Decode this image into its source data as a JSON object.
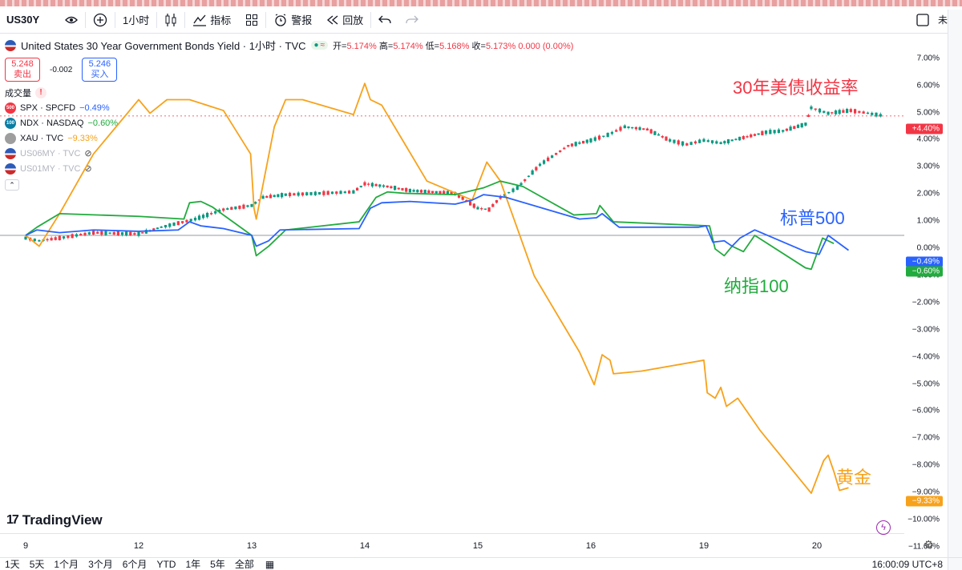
{
  "toolbar": {
    "symbol": "US30Y",
    "interval": "1小时",
    "indicators_label": "指标",
    "alert_label": "警报",
    "replay_label": "回放",
    "right_label": "未命"
  },
  "legend": {
    "main_title": "United States 30 Year Government Bonds Yield · 1小时 · TVC",
    "ohlc": {
      "open_label": "开=",
      "open": "5.174%",
      "high_label": "高=",
      "high": "5.174%",
      "low_label": "低=",
      "low": "5.168%",
      "close_label": "收=",
      "close": "5.173%",
      "change": "0.000 (0.00%)"
    },
    "sell_price": "5.248",
    "sell_label": "卖出",
    "spread": "-0.002",
    "buy_price": "5.246",
    "buy_label": "买入",
    "volume_label": "成交量",
    "rows": [
      {
        "icon": "500",
        "symbol": "SPX · SPCFD",
        "value": "−0.49%",
        "color": "#2962ff"
      },
      {
        "icon": "100",
        "symbol": "NDX · NASDAQ",
        "value": "−0.60%",
        "color": "#22ab3e"
      },
      {
        "icon": "",
        "symbol": "XAU · TVC",
        "value": "−9.33%",
        "color": "#f7a21b"
      },
      {
        "icon": "",
        "symbol": "US06MY · TVC",
        "value": "",
        "color": "#b2b5be"
      },
      {
        "icon": "",
        "symbol": "US01MY · TVC",
        "value": "",
        "color": "#b2b5be"
      }
    ]
  },
  "annotations": {
    "bond": "30年美债收益率",
    "spx": "标普500",
    "ndx": "纳指100",
    "gold": "黄金"
  },
  "ranges": [
    "1天",
    "5天",
    "1个月",
    "3个月",
    "6个月",
    "YTD",
    "1年",
    "5年",
    "全部"
  ],
  "clock": "16:00:09 UTC+8",
  "brand": "TradingView",
  "colors": {
    "gold": "#f7a21b",
    "ndx": "#22ab3e",
    "spx": "#2962ff",
    "up": "#089981",
    "down": "#f23645"
  },
  "chart_data": {
    "type": "line",
    "y_axis_unit": "%",
    "ylim": [
      -11,
      7.5
    ],
    "y_ticks": [
      "7.00%",
      "6.00%",
      "5.00%",
      "4.00%",
      "3.00%",
      "2.00%",
      "1.00%",
      "0.00%",
      "−1.00%",
      "−2.00%",
      "−3.00%",
      "−4.00%",
      "−5.00%",
      "−6.00%",
      "−7.00%",
      "−8.00%",
      "−9.00%",
      "−10.00%",
      "−11.00%"
    ],
    "x_ticks": [
      "9",
      "12",
      "13",
      "14",
      "15",
      "16",
      "19",
      "20"
    ],
    "grid": false,
    "series": [
      {
        "name": "XAU · TVC",
        "values": [
          [
            0,
            0.0
          ],
          [
            0.12,
            -0.4
          ],
          [
            0.3,
            0.8
          ],
          [
            0.6,
            3.0
          ],
          [
            1.0,
            5.0
          ],
          [
            1.1,
            4.5
          ],
          [
            1.25,
            5.0
          ],
          [
            1.45,
            5.0
          ],
          [
            1.75,
            4.6
          ],
          [
            1.99,
            3.0
          ],
          [
            2.02,
            1.0
          ],
          [
            2.04,
            0.6
          ],
          [
            2.2,
            4.0
          ],
          [
            2.3,
            5.0
          ],
          [
            2.45,
            5.0
          ],
          [
            2.9,
            4.45
          ],
          [
            3.0,
            5.6
          ],
          [
            3.05,
            5.0
          ],
          [
            3.15,
            4.8
          ],
          [
            3.55,
            2.0
          ],
          [
            3.95,
            1.3
          ],
          [
            4.08,
            2.7
          ],
          [
            4.2,
            2.0
          ],
          [
            4.5,
            -1.5
          ],
          [
            4.9,
            -4.3
          ],
          [
            5.03,
            -5.5
          ],
          [
            5.1,
            -4.4
          ],
          [
            5.17,
            -4.6
          ],
          [
            5.2,
            -5.1
          ],
          [
            5.45,
            -5.0
          ],
          [
            6.0,
            -4.6
          ],
          [
            6.03,
            -5.8
          ],
          [
            6.1,
            -6.0
          ],
          [
            6.15,
            -5.6
          ],
          [
            6.2,
            -6.3
          ],
          [
            6.3,
            -6.0
          ],
          [
            6.5,
            -7.2
          ],
          [
            6.95,
            -9.5
          ],
          [
            7.06,
            -8.3
          ],
          [
            7.1,
            -8.1
          ],
          [
            7.15,
            -8.7
          ],
          [
            7.2,
            -9.4
          ],
          [
            7.28,
            -9.3
          ]
        ],
        "color": "#f7a21b"
      },
      {
        "name": "NDX · NASDAQ",
        "values": [
          [
            0,
            0.0
          ],
          [
            0.1,
            0.3
          ],
          [
            0.3,
            0.8
          ],
          [
            1.0,
            0.7
          ],
          [
            1.4,
            0.6
          ],
          [
            1.45,
            1.2
          ],
          [
            1.55,
            1.25
          ],
          [
            1.65,
            1.05
          ],
          [
            2.0,
            0.0
          ],
          [
            2.04,
            -0.75
          ],
          [
            2.15,
            -0.4
          ],
          [
            2.3,
            0.2
          ],
          [
            2.95,
            0.5
          ],
          [
            3.1,
            1.4
          ],
          [
            3.2,
            1.6
          ],
          [
            3.35,
            1.55
          ],
          [
            3.8,
            1.5
          ],
          [
            4.05,
            1.75
          ],
          [
            4.2,
            2.0
          ],
          [
            4.4,
            1.8
          ],
          [
            4.85,
            0.75
          ],
          [
            5.05,
            0.8
          ],
          [
            5.08,
            1.1
          ],
          [
            5.2,
            0.5
          ],
          [
            6.05,
            0.35
          ],
          [
            6.1,
            -0.5
          ],
          [
            6.18,
            -0.75
          ],
          [
            6.25,
            -0.4
          ],
          [
            6.35,
            -0.6
          ],
          [
            6.45,
            0.0
          ],
          [
            6.9,
            -1.2
          ],
          [
            6.95,
            -1.25
          ],
          [
            7.05,
            -0.1
          ],
          [
            7.15,
            -0.3
          ]
        ],
        "color": "#22ab3e"
      },
      {
        "name": "SPX · SPCFD",
        "values": [
          [
            0,
            0.0
          ],
          [
            0.1,
            0.2
          ],
          [
            0.3,
            0.1
          ],
          [
            0.6,
            0.2
          ],
          [
            1.0,
            0.15
          ],
          [
            1.35,
            0.2
          ],
          [
            1.45,
            0.5
          ],
          [
            1.55,
            0.35
          ],
          [
            1.65,
            0.3
          ],
          [
            1.75,
            0.25
          ],
          [
            2.0,
            0.0
          ],
          [
            2.04,
            -0.4
          ],
          [
            2.15,
            -0.2
          ],
          [
            2.25,
            0.2
          ],
          [
            2.95,
            0.25
          ],
          [
            3.05,
            1.0
          ],
          [
            3.15,
            1.2
          ],
          [
            3.4,
            1.25
          ],
          [
            3.8,
            1.15
          ],
          [
            3.95,
            1.3
          ],
          [
            4.05,
            1.5
          ],
          [
            4.25,
            1.4
          ],
          [
            4.9,
            0.6
          ],
          [
            5.05,
            0.65
          ],
          [
            5.1,
            0.8
          ],
          [
            5.25,
            0.3
          ],
          [
            5.95,
            0.3
          ],
          [
            6.02,
            0.35
          ],
          [
            6.08,
            -0.25
          ],
          [
            6.18,
            -0.2
          ],
          [
            6.25,
            -0.4
          ],
          [
            6.32,
            -0.1
          ],
          [
            6.45,
            0.2
          ],
          [
            6.9,
            -0.6
          ],
          [
            7.02,
            -0.7
          ],
          [
            7.1,
            0.0
          ],
          [
            7.28,
            -0.55
          ]
        ],
        "color": "#2962ff"
      },
      {
        "name": "US30Y (hourly)",
        "style": "candles",
        "values": [
          [
            0,
            -0.1
          ],
          [
            0.12,
            -0.2
          ],
          [
            0.3,
            -0.1
          ],
          [
            0.6,
            0.1
          ],
          [
            1.0,
            0.05
          ],
          [
            1.2,
            0.3
          ],
          [
            1.5,
            0.6
          ],
          [
            1.75,
            0.95
          ],
          [
            2.0,
            1.1
          ],
          [
            2.1,
            1.4
          ],
          [
            2.3,
            1.5
          ],
          [
            2.6,
            1.55
          ],
          [
            2.9,
            1.6
          ],
          [
            3.0,
            1.9
          ],
          [
            3.2,
            1.8
          ],
          [
            3.4,
            1.65
          ],
          [
            3.6,
            1.6
          ],
          [
            3.8,
            1.55
          ],
          [
            4.0,
            1.0
          ],
          [
            4.1,
            0.95
          ],
          [
            4.2,
            1.4
          ],
          [
            4.35,
            1.75
          ],
          [
            4.55,
            2.6
          ],
          [
            4.8,
            3.3
          ],
          [
            5.0,
            3.5
          ],
          [
            5.15,
            3.7
          ],
          [
            5.3,
            4.0
          ],
          [
            5.5,
            3.9
          ],
          [
            5.7,
            3.5
          ],
          [
            5.85,
            3.35
          ],
          [
            6.0,
            3.5
          ],
          [
            6.15,
            3.4
          ],
          [
            6.35,
            3.6
          ],
          [
            6.55,
            3.8
          ],
          [
            6.7,
            3.85
          ],
          [
            6.9,
            4.1
          ],
          [
            6.95,
            4.7
          ],
          [
            7.1,
            4.5
          ],
          [
            7.3,
            4.6
          ],
          [
            7.45,
            4.5
          ],
          [
            7.6,
            4.4
          ]
        ],
        "color": "#089981"
      }
    ],
    "last_values": {
      "bond": "+4.40%",
      "spx": "−0.49%",
      "ndx": "−0.60%",
      "gold": "−9.33%",
      "zero": "0.00%"
    }
  }
}
